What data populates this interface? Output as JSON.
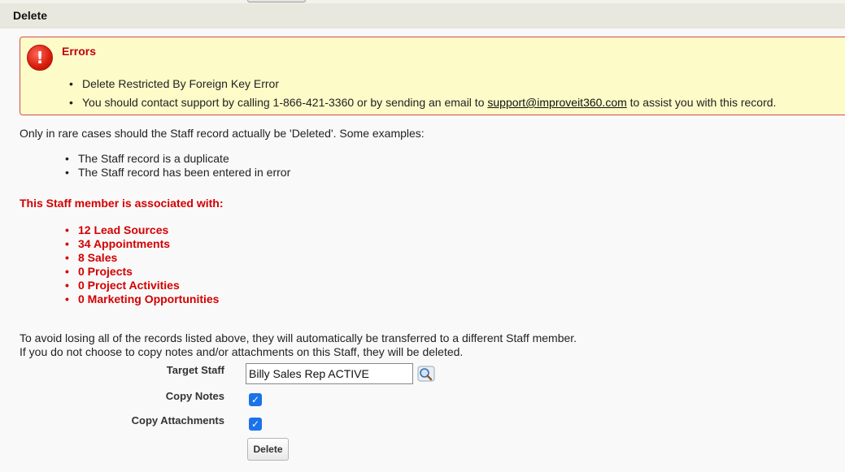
{
  "header": {
    "title": "Delete"
  },
  "errors": {
    "title": "Errors",
    "icon": "error-exclamation-icon",
    "items": [
      "Delete Restricted By Foreign Key Error",
      {
        "before": "You should contact support by calling 1-866-421-3360 or by sending an email to ",
        "email": "support@improveit360.com",
        "after": " to assist you with this record."
      }
    ]
  },
  "intro": "Only in rare cases should the Staff record actually be 'Deleted'. Some examples:",
  "examples": [
    "The Staff record is a duplicate",
    "The Staff record has been entered in error"
  ],
  "associations": {
    "title": "This Staff member is associated with:",
    "items": [
      "12 Lead Sources",
      "34 Appointments",
      "8 Sales",
      "0 Projects",
      "0 Project Activities",
      "0 Marketing Opportunities"
    ]
  },
  "transfer_note": {
    "line1": "To avoid losing all of the records listed above, they will automatically be transferred to a different Staff member.",
    "line2": "If you do not choose to copy notes and/or attachments on this Staff, they will be deleted."
  },
  "form": {
    "target_staff_label": "Target Staff",
    "target_staff_value": "Billy Sales Rep ACTIVE",
    "copy_notes_label": "Copy Notes",
    "copy_notes_checked": true,
    "copy_attachments_label": "Copy Attachments",
    "copy_attachments_checked": true,
    "delete_button": "Delete"
  },
  "colors": {
    "error_red": "#d40000",
    "error_box_bg": "#fdfbc8",
    "checkbox_blue": "#1a73e8"
  }
}
